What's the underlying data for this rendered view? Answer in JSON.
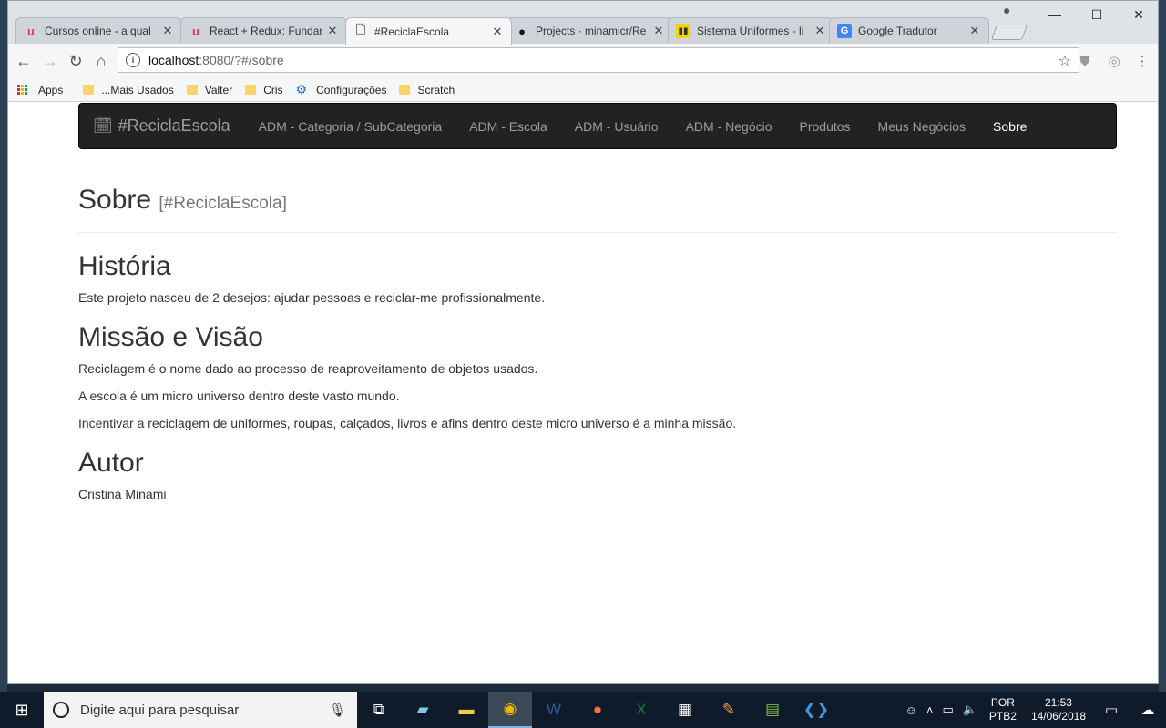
{
  "browser": {
    "tabs": [
      {
        "title": "Cursos online - a qual",
        "favicon": "udemy-icon",
        "active": false
      },
      {
        "title": "React + Redux: Fundar",
        "favicon": "udemy-icon",
        "active": false
      },
      {
        "title": "#ReciclaEscola",
        "favicon": "page-icon",
        "active": true
      },
      {
        "title": "Projects · minamicr/Re",
        "favicon": "github-icon",
        "active": false
      },
      {
        "title": "Sistema Uniformes - li",
        "favicon": "trello-icon",
        "active": false
      },
      {
        "title": "Google Tradutor",
        "favicon": "google-translate-icon",
        "active": false
      }
    ],
    "url_host": "localhost",
    "url_path": ":8080/?#/sobre",
    "bookmarks": [
      {
        "label": "Apps",
        "icon": "apps-grid-icon"
      },
      {
        "label": "...Mais Usados",
        "icon": "folder-icon"
      },
      {
        "label": "Valter",
        "icon": "folder-icon"
      },
      {
        "label": "Cris",
        "icon": "folder-icon"
      },
      {
        "label": "Configurações",
        "icon": "gear-icon"
      },
      {
        "label": "Scratch",
        "icon": "folder-icon"
      }
    ]
  },
  "app": {
    "brand": "#ReciclaEscola",
    "nav": [
      {
        "label": "ADM - Categoria / SubCategoria",
        "active": false
      },
      {
        "label": "ADM - Escola",
        "active": false
      },
      {
        "label": "ADM - Usuário",
        "active": false
      },
      {
        "label": "ADM - Negócio",
        "active": false
      },
      {
        "label": "Produtos",
        "active": false
      },
      {
        "label": "Meus Negócios",
        "active": false
      },
      {
        "label": "Sobre",
        "active": true
      }
    ],
    "header": {
      "title": "Sobre",
      "subtitle": "[#ReciclaEscola]"
    },
    "sections": [
      {
        "heading": "História",
        "paragraphs": [
          "Este projeto nasceu de 2 desejos: ajudar pessoas e reciclar-me profissionalmente."
        ]
      },
      {
        "heading": "Missão e Visão",
        "paragraphs": [
          "Reciclagem é o nome dado ao processo de reaproveitamento de objetos usados.",
          "A escola é um micro universo dentro deste vasto mundo.",
          "Incentivar a reciclagem de uniformes, roupas, calçados, livros e afins dentro deste micro universo é a minha missão."
        ]
      },
      {
        "heading": "Autor",
        "paragraphs": [
          "Cristina Minami"
        ]
      }
    ]
  },
  "taskbar": {
    "search_placeholder": "Digite aqui para pesquisar",
    "lang_top": "POR",
    "lang_bottom": "PTB2",
    "time": "21:53",
    "date": "14/06/2018"
  },
  "colors": {
    "navbar_bg": "#222222",
    "nav_link": "#9d9d9d",
    "nav_active": "#ffffff"
  }
}
